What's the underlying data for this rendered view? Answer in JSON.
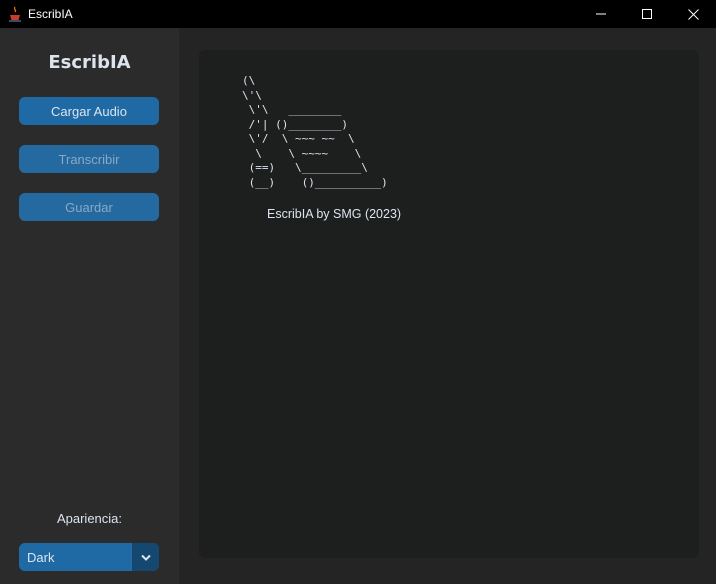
{
  "window": {
    "title": "EscribIA",
    "app_icon": "java-cup-icon",
    "controls": [
      "minimize-icon",
      "maximize-icon",
      "close-icon"
    ]
  },
  "sidebar": {
    "logo": "EscribIA",
    "buttons": [
      {
        "label": "Cargar Audio",
        "enabled": true
      },
      {
        "label": "Transcribir",
        "enabled": false
      },
      {
        "label": "Guardar",
        "enabled": false
      }
    ],
    "appearance_label": "Apariencia:",
    "appearance_select": {
      "value": "Dark",
      "icon": "chevron-down-icon"
    }
  },
  "main": {
    "ascii_art": "(\\\n\\'\\\n \\'\\   ________\n /'| ()________)\n \\'/  \\ ~~~ ~~  \\\n  \\    \\ ~~~~    \\\n (==)   \\_________\\\n (__)    ()__________)",
    "credit": "EscribIA by SMG (2023)"
  },
  "colors": {
    "titlebar": "#000000",
    "sidebar": "#2b2b2b",
    "background": "#242424",
    "panel": "#1d1e1e",
    "accent": "#1f6aa5",
    "accent_dark": "#144870",
    "text": "#dce4ee"
  }
}
